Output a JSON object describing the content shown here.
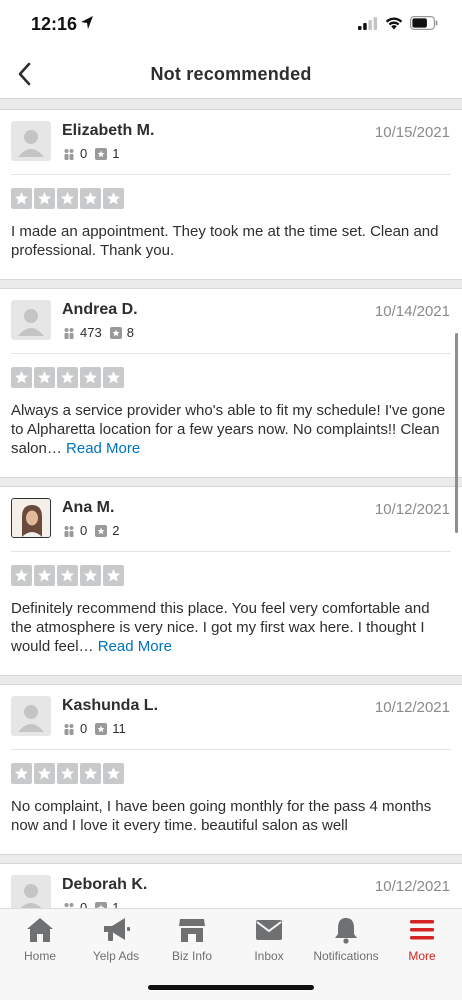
{
  "status_bar": {
    "time": "12:16"
  },
  "header": {
    "title": "Not recommended"
  },
  "reviews": [
    {
      "name": "Elizabeth M.",
      "date": "10/15/2021",
      "friends": "0",
      "reviews": "1",
      "text": "I made an appointment. They took me at the time set. Clean and professional. Thank you.",
      "read_more": ""
    },
    {
      "name": "Andrea D.",
      "date": "10/14/2021",
      "friends": "473",
      "reviews": "8",
      "text": "Always a service provider who's able to fit my schedule! I've gone to Alpharetta location for a few years now. No complaints!! Clean salon… ",
      "read_more": "Read More"
    },
    {
      "name": "Ana M.",
      "date": "10/12/2021",
      "friends": "0",
      "reviews": "2",
      "text": "Definitely recommend this place. You feel very comfortable and the atmosphere is very nice. I got my first wax here. I thought I would feel… ",
      "read_more": "Read More"
    },
    {
      "name": "Kashunda L.",
      "date": "10/12/2021",
      "friends": "0",
      "reviews": "11",
      "text": "No complaint, I have been going monthly for the pass 4 months now and I love it every time. beautiful salon as well",
      "read_more": ""
    },
    {
      "name": "Deborah K.",
      "date": "10/12/2021",
      "friends": "0",
      "reviews": "1",
      "text": "",
      "read_more": ""
    }
  ],
  "rating_level": "0 of 5 (stars shown grey)",
  "tabs": [
    {
      "label": "Home",
      "icon": "home-icon"
    },
    {
      "label": "Yelp Ads",
      "icon": "megaphone-icon"
    },
    {
      "label": "Biz Info",
      "icon": "storefront-icon"
    },
    {
      "label": "Inbox",
      "icon": "envelope-icon"
    },
    {
      "label": "Notifications",
      "icon": "bell-icon"
    },
    {
      "label": "More",
      "icon": "hamburger-icon"
    }
  ],
  "colors": {
    "accent": "#d32323",
    "link": "#0073bb",
    "star_empty": "#c8c9ca",
    "tab_inactive": "#6e7072"
  }
}
